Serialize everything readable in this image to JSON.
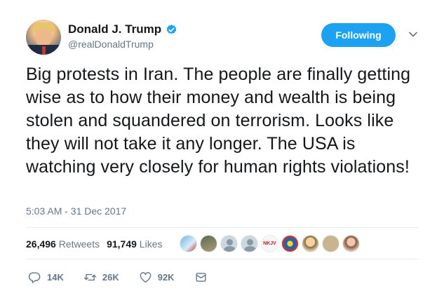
{
  "author": {
    "name": "Donald J. Trump",
    "handle": "@realDonaldTrump",
    "verified": true,
    "avatar": "profile-photo"
  },
  "follow_button": {
    "label": "Following"
  },
  "menu": {
    "icon": "chevron-down-icon"
  },
  "tweet": {
    "text": "Big protests in Iran. The people are finally getting wise as to how their money and wealth is being stolen and squandered on terrorism. Looks like they will not take it any longer. The USA is watching very closely for human rights violations!",
    "timestamp": "5:03 AM - 31 Dec 2017"
  },
  "stats": {
    "retweets": {
      "count": "26,496",
      "label": "Retweets"
    },
    "likes": {
      "count": "91,749",
      "label": "Likes"
    }
  },
  "liker_avatars": [
    {
      "type": "photo"
    },
    {
      "type": "photo"
    },
    {
      "type": "default"
    },
    {
      "type": "default"
    },
    {
      "type": "logo",
      "text": "NKJV"
    },
    {
      "type": "photo"
    },
    {
      "type": "photo"
    },
    {
      "type": "photo"
    },
    {
      "type": "photo"
    }
  ],
  "actions": {
    "reply": {
      "icon": "reply-icon",
      "count": "14K"
    },
    "retweet": {
      "icon": "retweet-icon",
      "count": "26K"
    },
    "like": {
      "icon": "heart-icon",
      "count": "92K"
    },
    "message": {
      "icon": "mail-icon"
    }
  },
  "colors": {
    "accent": "#1da1f2",
    "text": "#14171a",
    "secondary": "#657786",
    "divider": "#e6ecf0"
  }
}
